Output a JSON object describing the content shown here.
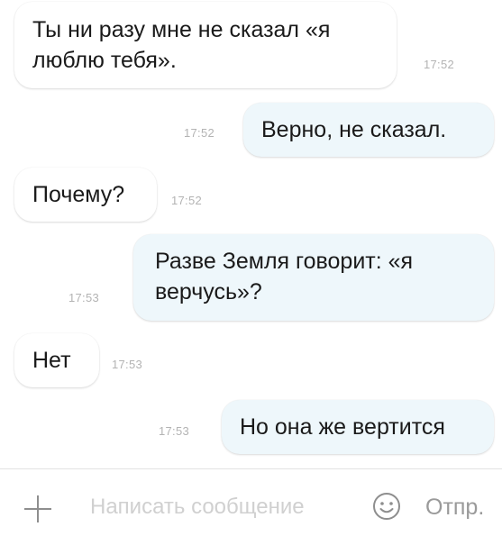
{
  "messages": [
    {
      "direction": "in",
      "text": "Ты ни разу мне не сказал «я\nлюблю тебя».",
      "time": "17:52"
    },
    {
      "direction": "out",
      "text": "Верно, не сказал.",
      "time": "17:52"
    },
    {
      "direction": "in",
      "text": "Почему?",
      "time": "17:52"
    },
    {
      "direction": "out",
      "text": "Разве Земля говорит: «я\nверчусь»?",
      "time": "17:53"
    },
    {
      "direction": "in",
      "text": "Нет",
      "time": "17:53"
    },
    {
      "direction": "out",
      "text": "Но она же вертится",
      "time": "17:53"
    }
  ],
  "composer": {
    "attach_icon": "plus-icon",
    "placeholder": "Написать сообщение",
    "emoji_icon": "smiley-icon",
    "send_label": "Отпр."
  },
  "colors": {
    "incoming_bubble": "#ffffff",
    "outgoing_bubble": "#eef7fb",
    "timestamp": "#b3b3b3",
    "placeholder": "#d0d0d0",
    "icon": "#8e8e8e"
  }
}
